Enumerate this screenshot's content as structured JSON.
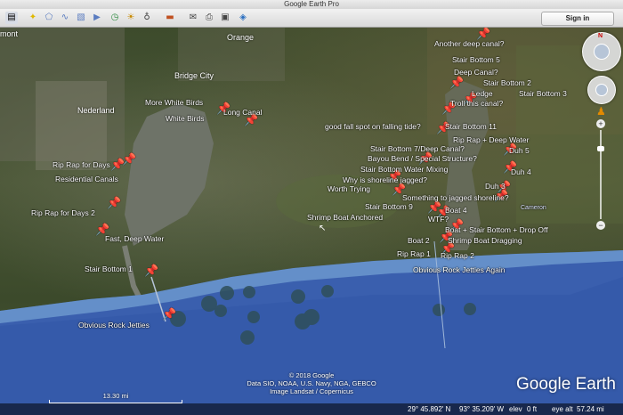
{
  "window": {
    "title": "Google Earth Pro",
    "sign_in": "Sign in"
  },
  "toolbar_icons": [
    "sidebar-icon",
    "placemark-icon",
    "polygon-icon",
    "path-icon",
    "overlay-icon",
    "tour-icon",
    "historical-imagery-icon",
    "sunlight-icon",
    "planets-icon",
    "ruler-icon",
    "email-icon",
    "print-icon",
    "save-image-icon",
    "maps-icon"
  ],
  "towns": {
    "orange": "Orange",
    "bridge_city": "Bridge City",
    "nederland": "Nederland",
    "port": "mont"
  },
  "placemarks": {
    "more_white_birds": "More White Birds",
    "white_birds": "White Birds",
    "long_canal": "Long Canal",
    "another_deep_canal": "Another deep canal?",
    "stair_bottom_5": "Stair Bottom 5",
    "deep_canal": "Deep Canal?",
    "stair_bottom_2": "Stair Bottom 2",
    "ledge": "Ledge",
    "stair_bottom_3": "Stair Bottom 3",
    "troll_this_canal": "Troll this canal?",
    "good_fall_spot": "good fall spot on falling tide?",
    "stair_bottom_11": "Stair Bottom 11",
    "rip_rap_deep_water": "Rip Rap + Deep Water",
    "stair_bottom_deep_canal": "Stair Bottom 7/Deep Canal?",
    "duh_5": "Duh 5",
    "bayou_bend": "Bayou Bend / Special Structure?",
    "stair_bottom_water_mixing": "Stair Bottom Water Mixing",
    "duh_4": "Duh 4",
    "why_jagged": "Why is shoreline jagged?",
    "worth_trying": "Worth Trying",
    "duh_3": "Duh 3",
    "something_jagged": "Something to jagged shoreline?",
    "stair_bottom_9": "Stair Bottom 9",
    "boat_4": "Boat 4",
    "shrimp_boat_anchored": "Shrimp Boat Anchored",
    "wtf": "WTF?",
    "boat_stair_drop": "Boat + Stair Bottom + Drop Off",
    "boat_2": "Boat 2",
    "shrimp_boat_dragging": "Shrimp Boat Dragging",
    "rip_rap_1": "Rip Rap 1",
    "rip_rap_2": "Rip Rap 2",
    "obvious_jetties_again": "Obvious Rock Jetties Again",
    "rip_rap_days": "Rip Rap for Days",
    "residential_canals": "Residential Canals",
    "rip_rap_days_2": "Rip Rap for Days 2",
    "fast_deep_water": "Fast, Deep Water",
    "stair_bottom_1": "Stair Bottom 1",
    "obvious_jetties": "Obvious Rock Jetties",
    "cameron": "Cameron"
  },
  "attribution": {
    "line1": "© 2018 Google",
    "line2": "Data SIO, NOAA, U.S. Navy, NGA, GEBCO",
    "line3": "Image Landsat / Copernicus"
  },
  "brand": "Google Earth",
  "scale": "13.30 mi",
  "status": {
    "lat": "29° 45.892' N",
    "lon": "93° 35.209' W",
    "elev_label": "elev",
    "elev": "0 ft",
    "eye_label": "eye alt",
    "eye_alt": "57.24 mi"
  },
  "colors": {
    "pin": "#f5d200",
    "ocean": "#3a5fae"
  }
}
